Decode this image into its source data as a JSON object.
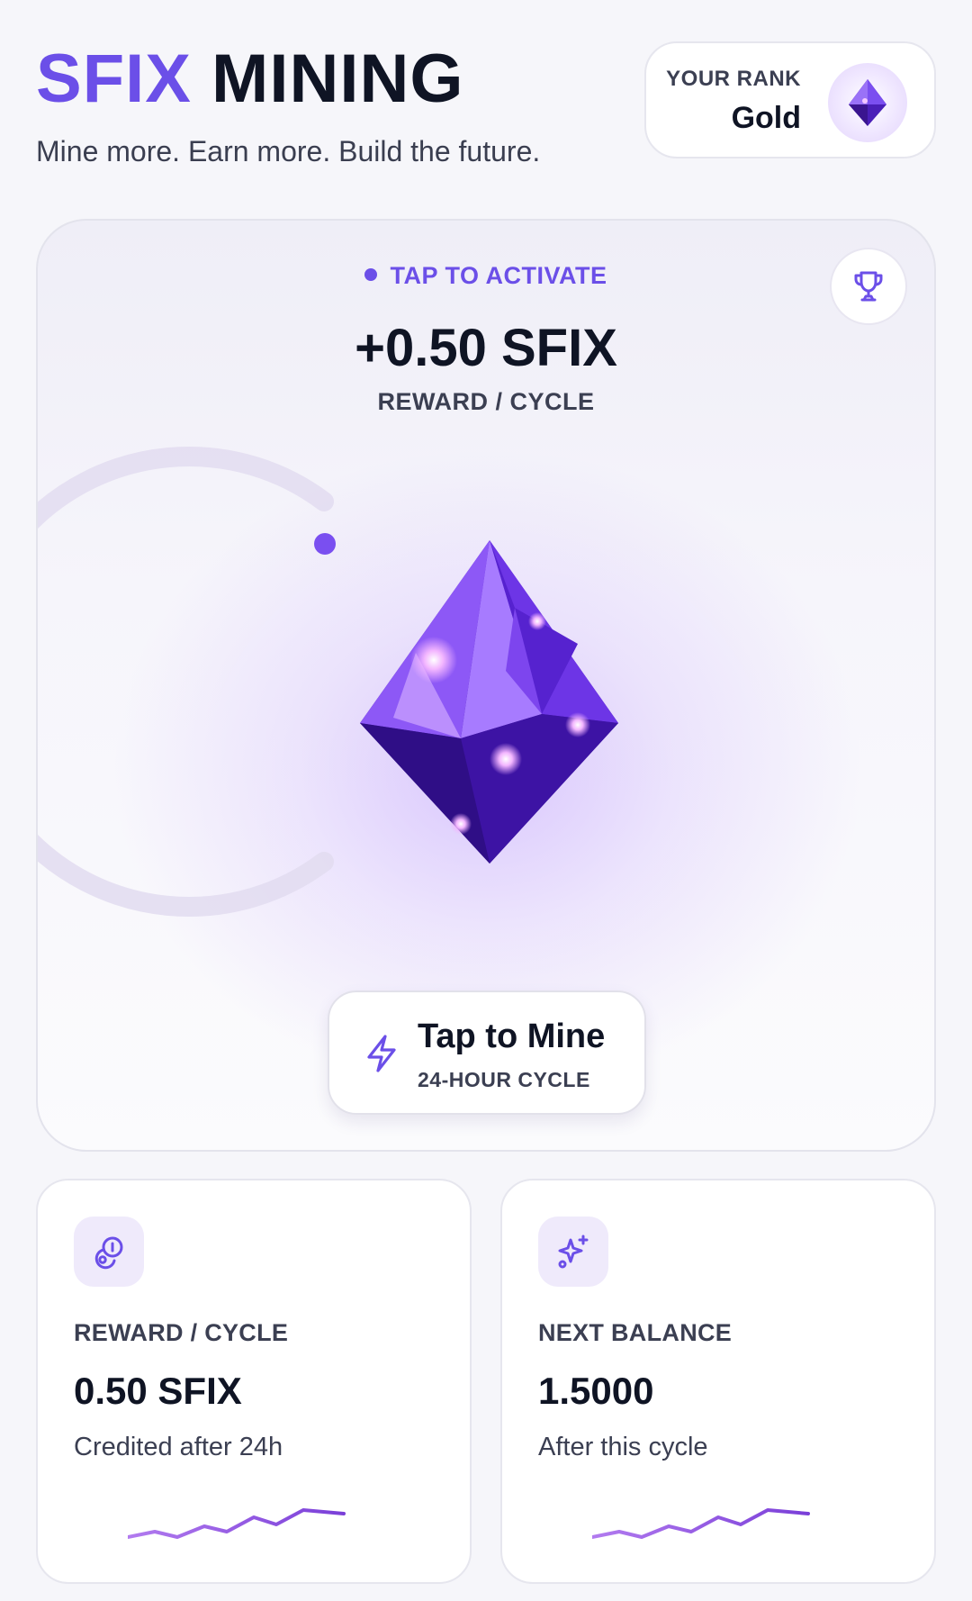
{
  "header": {
    "brand_accent": "SFIX",
    "brand_rest": "MINING",
    "tagline": "Mine more. Earn more. Build the future."
  },
  "rank": {
    "label": "YOUR RANK",
    "value": "Gold",
    "icon": "diamond-gem-icon"
  },
  "mining": {
    "status": "TAP TO ACTIVATE",
    "reward_amount": "+0.50 SFIX",
    "reward_label": "REWARD / CYCLE",
    "trophy_icon": "trophy-icon",
    "tap_title": "Tap to Mine",
    "tap_subtitle": "24-HOUR CYCLE",
    "tap_icon": "lightning-icon"
  },
  "stats": [
    {
      "icon": "coins-icon",
      "label": "REWARD / CYCLE",
      "value": "0.50 SFIX",
      "note": "Credited after 24h"
    },
    {
      "icon": "sparkles-icon",
      "label": "NEXT BALANCE",
      "value": "1.5000",
      "note": "After this cycle"
    }
  ],
  "colors": {
    "accent": "#6b4fe8",
    "text_dark": "#0f1424",
    "text_muted": "#3b3f52",
    "gem_purple": "#5b2bd6"
  }
}
